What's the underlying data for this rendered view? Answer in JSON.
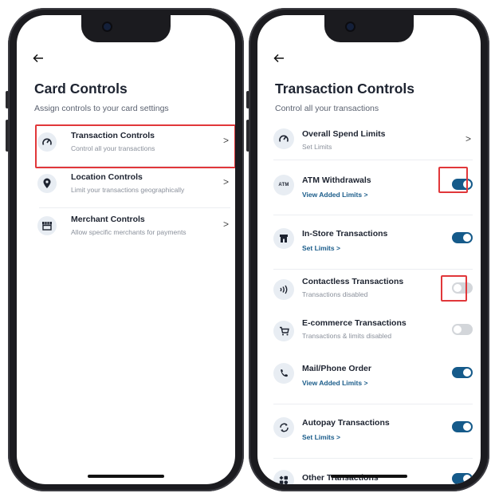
{
  "card_controls": {
    "back_icon": "arrow-left-icon",
    "title": "Card Controls",
    "subtitle": "Assign controls to your card settings",
    "items": [
      {
        "label": "Transaction Controls",
        "sub": "Control all your transactions",
        "icon": "speedometer-icon"
      },
      {
        "label": "Location Controls",
        "sub": "Limit your transactions geographically",
        "icon": "location-pin-icon"
      },
      {
        "label": "Merchant Controls",
        "sub": "Allow specific merchants for payments",
        "icon": "store-icon"
      }
    ]
  },
  "transaction_controls": {
    "back_icon": "arrow-left-icon",
    "title": "Transaction Controls",
    "subtitle": "Control all your transactions",
    "items": [
      {
        "label": "Overall Spend Limits",
        "sub": "Set Limits",
        "icon": "speedometer-icon"
      },
      {
        "label": "ATM Withdrawals",
        "link": "View Added Limits",
        "icon": "atm-icon",
        "toggle": "on"
      },
      {
        "label": "In-Store Transactions",
        "link": "Set Limits",
        "icon": "store-icon",
        "toggle": "on"
      },
      {
        "label": "Contactless Transactions",
        "sub": "Transactions disabled",
        "icon": "contactless-icon",
        "toggle": "off"
      },
      {
        "label": "E-commerce Transactions",
        "sub": "Transactions & limits disabled",
        "icon": "cart-icon",
        "toggle": "off"
      },
      {
        "label": "Mail/Phone Order",
        "link": "View Added Limits",
        "icon": "phone-icon",
        "toggle": "on"
      },
      {
        "label": "Autopay Transactions",
        "link": "Set Limits",
        "icon": "autopay-icon",
        "toggle": "on"
      },
      {
        "label": "Other Transactions",
        "icon": "grid-icon",
        "toggle": "on"
      }
    ]
  },
  "link_chevron": ">",
  "chevron": ">",
  "atm_icon_text": "ATM",
  "colors": {
    "accent": "#155a8a",
    "highlight": "#e1373a",
    "toggle_off": "#d3d6da"
  }
}
